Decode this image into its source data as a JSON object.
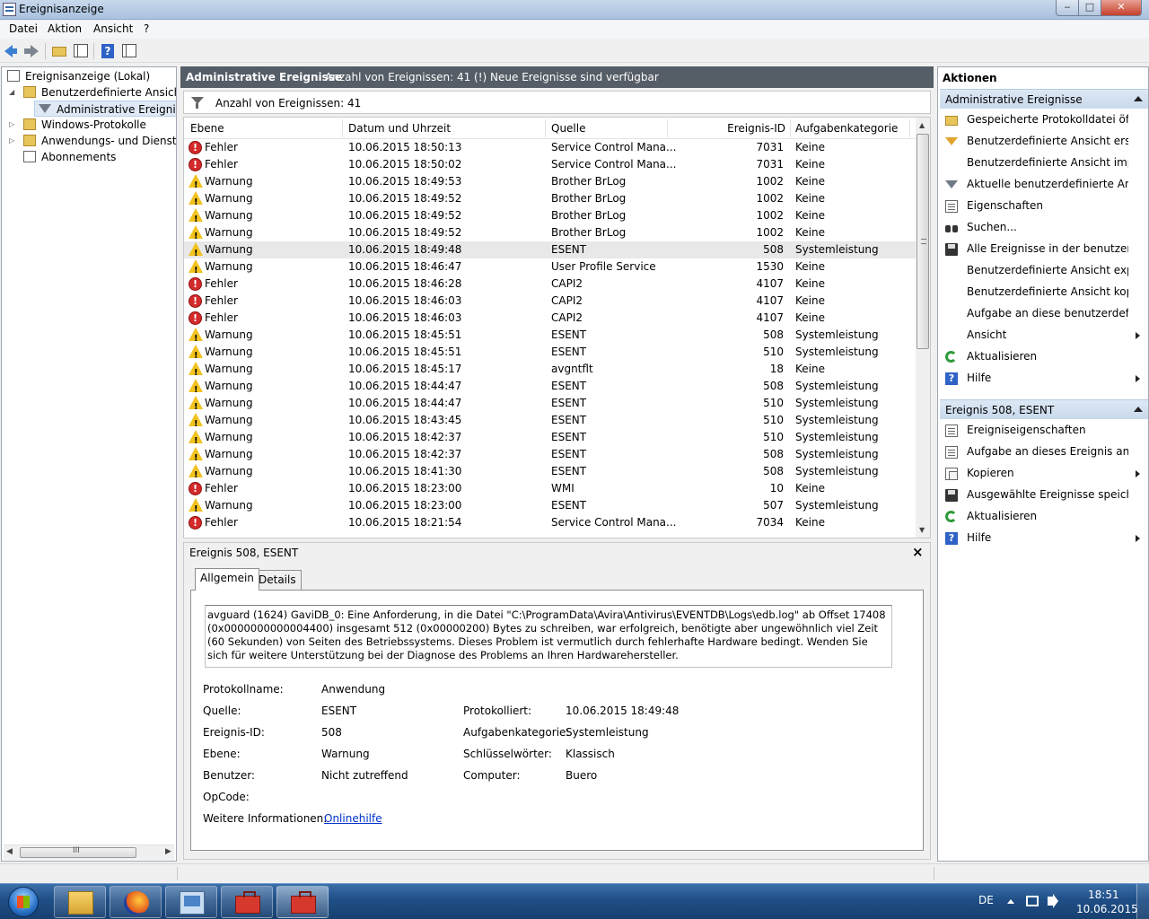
{
  "window": {
    "title": "Ereignisanzeige",
    "min": "‒",
    "max": "□",
    "close": "✕"
  },
  "menu": [
    "Datei",
    "Aktion",
    "Ansicht",
    "?"
  ],
  "tree": {
    "items": [
      {
        "label": "Ereignisanzeige (Lokal)"
      },
      {
        "label": "Benutzerdefinierte Ansichten"
      },
      {
        "label": "Administrative Ereignisse"
      },
      {
        "label": "Windows-Protokolle"
      },
      {
        "label": "Anwendungs- und Dienstprotokolle"
      },
      {
        "label": "Abonnements"
      }
    ],
    "scroll_grip": "III"
  },
  "middle": {
    "header_title": "Administrative Ereignisse",
    "header_info": "Anzahl von Ereignissen: 41 (!) Neue Ereignisse sind verfügbar",
    "filter_label": "Anzahl von Ereignissen: 41",
    "columns": [
      "Ebene",
      "Datum und Uhrzeit",
      "Quelle",
      "Ereignis-ID",
      "Aufgabenkategorie"
    ],
    "rows": [
      {
        "level": "Fehler",
        "type": "error",
        "datetime": "10.06.2015 18:50:13",
        "source": "Service Control Mana...",
        "id": "7031",
        "category": "Keine"
      },
      {
        "level": "Fehler",
        "type": "error",
        "datetime": "10.06.2015 18:50:02",
        "source": "Service Control Mana...",
        "id": "7031",
        "category": "Keine"
      },
      {
        "level": "Warnung",
        "type": "warning",
        "datetime": "10.06.2015 18:49:53",
        "source": "Brother BrLog",
        "id": "1002",
        "category": "Keine"
      },
      {
        "level": "Warnung",
        "type": "warning",
        "datetime": "10.06.2015 18:49:52",
        "source": "Brother BrLog",
        "id": "1002",
        "category": "Keine"
      },
      {
        "level": "Warnung",
        "type": "warning",
        "datetime": "10.06.2015 18:49:52",
        "source": "Brother BrLog",
        "id": "1002",
        "category": "Keine"
      },
      {
        "level": "Warnung",
        "type": "warning",
        "datetime": "10.06.2015 18:49:52",
        "source": "Brother BrLog",
        "id": "1002",
        "category": "Keine"
      },
      {
        "level": "Warnung",
        "type": "warning",
        "datetime": "10.06.2015 18:49:48",
        "source": "ESENT",
        "id": "508",
        "category": "Systemleistung",
        "selected": true
      },
      {
        "level": "Warnung",
        "type": "warning",
        "datetime": "10.06.2015 18:46:47",
        "source": "User Profile Service",
        "id": "1530",
        "category": "Keine"
      },
      {
        "level": "Fehler",
        "type": "error",
        "datetime": "10.06.2015 18:46:28",
        "source": "CAPI2",
        "id": "4107",
        "category": "Keine"
      },
      {
        "level": "Fehler",
        "type": "error",
        "datetime": "10.06.2015 18:46:03",
        "source": "CAPI2",
        "id": "4107",
        "category": "Keine"
      },
      {
        "level": "Fehler",
        "type": "error",
        "datetime": "10.06.2015 18:46:03",
        "source": "CAPI2",
        "id": "4107",
        "category": "Keine"
      },
      {
        "level": "Warnung",
        "type": "warning",
        "datetime": "10.06.2015 18:45:51",
        "source": "ESENT",
        "id": "508",
        "category": "Systemleistung"
      },
      {
        "level": "Warnung",
        "type": "warning",
        "datetime": "10.06.2015 18:45:51",
        "source": "ESENT",
        "id": "510",
        "category": "Systemleistung"
      },
      {
        "level": "Warnung",
        "type": "warning",
        "datetime": "10.06.2015 18:45:17",
        "source": "avgntflt",
        "id": "18",
        "category": "Keine"
      },
      {
        "level": "Warnung",
        "type": "warning",
        "datetime": "10.06.2015 18:44:47",
        "source": "ESENT",
        "id": "508",
        "category": "Systemleistung"
      },
      {
        "level": "Warnung",
        "type": "warning",
        "datetime": "10.06.2015 18:44:47",
        "source": "ESENT",
        "id": "510",
        "category": "Systemleistung"
      },
      {
        "level": "Warnung",
        "type": "warning",
        "datetime": "10.06.2015 18:43:45",
        "source": "ESENT",
        "id": "510",
        "category": "Systemleistung"
      },
      {
        "level": "Warnung",
        "type": "warning",
        "datetime": "10.06.2015 18:42:37",
        "source": "ESENT",
        "id": "510",
        "category": "Systemleistung"
      },
      {
        "level": "Warnung",
        "type": "warning",
        "datetime": "10.06.2015 18:42:37",
        "source": "ESENT",
        "id": "508",
        "category": "Systemleistung"
      },
      {
        "level": "Warnung",
        "type": "warning",
        "datetime": "10.06.2015 18:41:30",
        "source": "ESENT",
        "id": "508",
        "category": "Systemleistung"
      },
      {
        "level": "Fehler",
        "type": "error",
        "datetime": "10.06.2015 18:23:00",
        "source": "WMI",
        "id": "10",
        "category": "Keine"
      },
      {
        "level": "Warnung",
        "type": "warning",
        "datetime": "10.06.2015 18:23:00",
        "source": "ESENT",
        "id": "507",
        "category": "Systemleistung"
      },
      {
        "level": "Fehler",
        "type": "error",
        "datetime": "10.06.2015 18:21:54",
        "source": "Service Control Mana...",
        "id": "7034",
        "category": "Keine"
      }
    ]
  },
  "detail": {
    "title": "Ereignis 508, ESENT",
    "close": "×",
    "tabs": [
      "Allgemein",
      "Details"
    ],
    "description": "avguard (1624) GaviDB_0: Eine Anforderung, in die Datei \"C:\\ProgramData\\Avira\\Antivirus\\EVENTDB\\Logs\\edb.log\" ab Offset 17408 (0x0000000000004400) insgesamt 512 (0x00000200) Bytes zu schreiben, war erfolgreich, benötigte aber ungewöhnlich viel Zeit (60 Sekunden) von Seiten des Betriebssystems. Dieses Problem ist vermutlich durch fehlerhafte Hardware bedingt. Wenden Sie sich für weitere Unterstützung bei der Diagnose des Problems an Ihren Hardwarehersteller.",
    "fields": {
      "protokollname_label": "Protokollname:",
      "protokollname": "Anwendung",
      "quelle_label": "Quelle:",
      "quelle": "ESENT",
      "protokolliert_label": "Protokolliert:",
      "protokolliert": "10.06.2015 18:49:48",
      "ereignisid_label": "Ereignis-ID:",
      "ereignisid": "508",
      "aufgabe_label": "Aufgabenkategorie:",
      "aufgabe": "Systemleistung",
      "ebene_label": "Ebene:",
      "ebene": "Warnung",
      "schluessel_label": "Schlüsselwörter:",
      "schluessel": "Klassisch",
      "benutzer_label": "Benutzer:",
      "benutzer": "Nicht zutreffend",
      "computer_label": "Computer:",
      "computer": "Buero",
      "opcode_label": "OpCode:",
      "weitere_label": "Weitere Informationen:",
      "weitere_link": "Onlinehilfe"
    }
  },
  "actions": {
    "title": "Aktionen",
    "section1": "Administrative Ereignisse",
    "section1_items": [
      {
        "label": "Gespeicherte Protokolldatei öff...",
        "icon": "folder"
      },
      {
        "label": "Benutzerdefinierte Ansicht erste...",
        "icon": "funnel-y"
      },
      {
        "label": "Benutzerdefinierte Ansicht imp...",
        "icon": ""
      },
      {
        "label": "Aktuelle benutzerdefinierte Ansi...",
        "icon": "funnel"
      },
      {
        "label": "Eigenschaften",
        "icon": "props"
      },
      {
        "label": "Suchen...",
        "icon": "bino"
      },
      {
        "label": "Alle Ereignisse in der benutzerd...",
        "icon": "disk"
      },
      {
        "label": "Benutzerdefinierte Ansicht expo...",
        "icon": ""
      },
      {
        "label": "Benutzerdefinierte Ansicht kopi...",
        "icon": ""
      },
      {
        "label": "Aufgabe an diese benutzerdefin...",
        "icon": ""
      },
      {
        "label": "Ansicht",
        "icon": "",
        "submenu": true
      },
      {
        "label": "Aktualisieren",
        "icon": "refresh"
      },
      {
        "label": "Hilfe",
        "icon": "help",
        "submenu": true
      }
    ],
    "section2": "Ereignis 508, ESENT",
    "section2_items": [
      {
        "label": "Ereigniseigenschaften",
        "icon": "props"
      },
      {
        "label": "Aufgabe an dieses Ereignis anfü...",
        "icon": "props"
      },
      {
        "label": "Kopieren",
        "icon": "copy",
        "submenu": true
      },
      {
        "label": "Ausgewählte Ereignisse speiche...",
        "icon": "disk"
      },
      {
        "label": "Aktualisieren",
        "icon": "refresh"
      },
      {
        "label": "Hilfe",
        "icon": "help",
        "submenu": true
      }
    ]
  },
  "taskbar": {
    "language": "DE",
    "time": "18:51",
    "date": "10.06.2015"
  }
}
